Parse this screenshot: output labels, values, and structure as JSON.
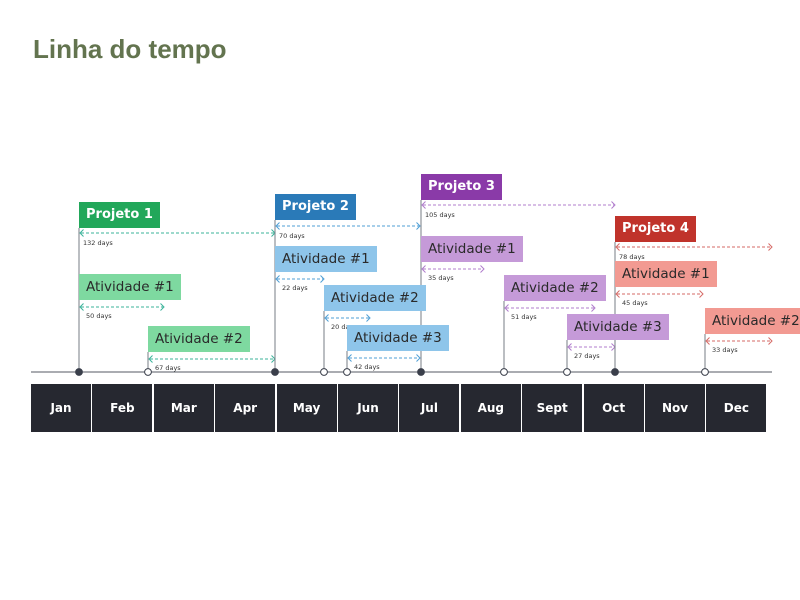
{
  "title": "Linha do tempo",
  "months": [
    "Jan",
    "Feb",
    "Mar",
    "Apr",
    "May",
    "Jun",
    "Jul",
    "Aug",
    "Sept",
    "Oct",
    "Nov",
    "Dec"
  ],
  "colors": {
    "text_title": "#63744f",
    "month_bar": "#262830",
    "axis": "#555a63"
  },
  "projects": [
    {
      "label": "Projeto 1",
      "duration": "132 days",
      "color": "#22a75a",
      "light": "#7ed9a0",
      "arrow": "#3bb39a",
      "activities": [
        {
          "label": "Atividade #1",
          "duration": "50 days"
        },
        {
          "label": "Atividade #2",
          "duration": "67 days"
        }
      ]
    },
    {
      "label": "Projeto 2",
      "duration": "70 days",
      "color": "#2a7ab8",
      "light": "#8ec5ea",
      "arrow": "#4f9fd6",
      "activities": [
        {
          "label": "Atividade #1",
          "duration": "22 days"
        },
        {
          "label": "Atividade #2",
          "duration": "20 days"
        },
        {
          "label": "Atividade #3",
          "duration": "42 days"
        }
      ]
    },
    {
      "label": "Projeto 3",
      "duration": "105 days",
      "color": "#8a3aa8",
      "light": "#c59ad8",
      "arrow": "#b07ccc",
      "activities": [
        {
          "label": "Atividade #1",
          "duration": "35 days"
        },
        {
          "label": "Atividade #2",
          "duration": "51 days"
        },
        {
          "label": "Atividade #3",
          "duration": "27 days"
        }
      ]
    },
    {
      "label": "Projeto 4",
      "duration": "78 days",
      "color": "#c0332b",
      "light": "#f29a92",
      "arrow": "#d66a66",
      "activities": [
        {
          "label": "Atividade #1",
          "duration": "45 days"
        },
        {
          "label": "Atividade #2",
          "duration": "33 days"
        }
      ]
    }
  ]
}
